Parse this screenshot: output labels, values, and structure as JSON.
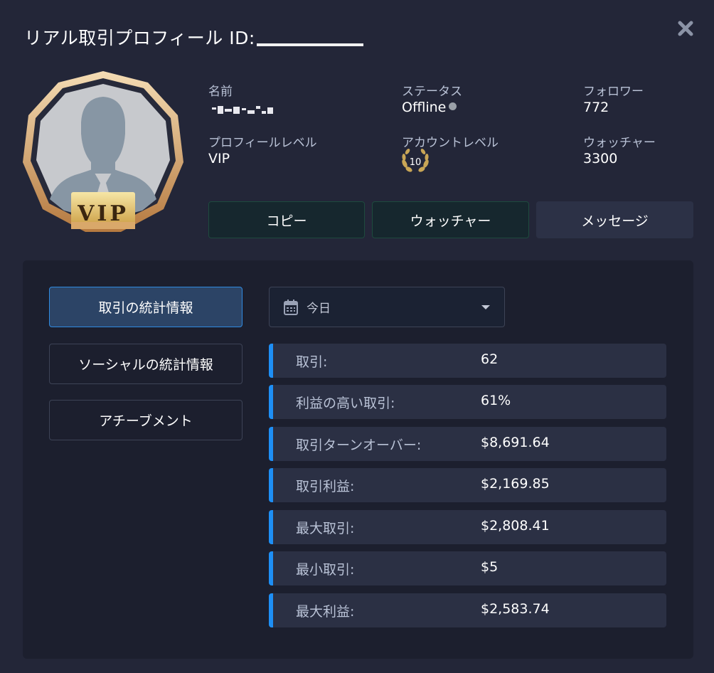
{
  "title": "リアル取引プロフィール ID:",
  "avatar": {
    "badge": "VIP"
  },
  "profile": {
    "name_label": "名前",
    "status_label": "ステータス",
    "status_value": "Offline",
    "followers_label": "フォロワー",
    "followers_value": "772",
    "profile_level_label": "プロフィールレベル",
    "profile_level_value": "VIP",
    "account_level_label": "アカウントレベル",
    "account_level_value": "10",
    "watchers_label": "ウォッチャー",
    "watchers_value": "3300"
  },
  "actions": {
    "copy": "コピー",
    "watch": "ウォッチャー",
    "message": "メッセージ"
  },
  "tabs": [
    {
      "label": "取引の統計情報",
      "active": true
    },
    {
      "label": "ソーシャルの統計情報",
      "active": false
    },
    {
      "label": "アチーブメント",
      "active": false
    }
  ],
  "period_select": {
    "value": "今日"
  },
  "stats": [
    {
      "label": "取引:",
      "value": "62"
    },
    {
      "label": "利益の高い取引:",
      "value": "61%"
    },
    {
      "label": "取引ターンオーバー:",
      "value": "$8,691.64"
    },
    {
      "label": "取引利益:",
      "value": "$2,169.85"
    },
    {
      "label": "最大取引:",
      "value": "$2,808.41"
    },
    {
      "label": "最小取引:",
      "value": "$5"
    },
    {
      "label": "最大利益:",
      "value": "$2,583.74"
    }
  ],
  "colors": {
    "background": "#232638",
    "panel": "#1c1f2e",
    "accent_blue": "#1e8ff5",
    "gold": "#d9a86a"
  }
}
